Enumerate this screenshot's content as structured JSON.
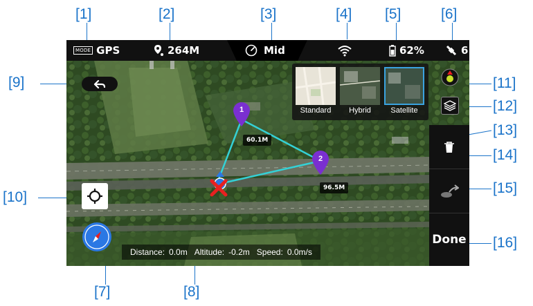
{
  "callouts": [
    "[1]",
    "[2]",
    "[3]",
    "[4]",
    "[5]",
    "[6]",
    "[7]",
    "[8]",
    "[9]",
    "[10]",
    "[11]",
    "[12]",
    "[13]",
    "[14]",
    "[15]",
    "[16]"
  ],
  "status_bar": {
    "mode_badge": "MODE",
    "gps_label": "GPS",
    "distance": "264M",
    "speed_mode": "Mid",
    "battery": "62%",
    "satellites": "6"
  },
  "map_types": {
    "options": [
      "Standard",
      "Hybrid",
      "Satellite"
    ],
    "selected": "Satellite"
  },
  "waypoints": [
    {
      "number": "1",
      "distance_label": "60.1M"
    },
    {
      "number": "2",
      "distance_label": "96.5M"
    }
  ],
  "info_bar": {
    "distance_label": "Distance:",
    "distance_value": "0.0m",
    "altitude_label": "Altitude:",
    "altitude_value": "-0.2m",
    "speed_label": "Speed:",
    "speed_value": "0.0m/s"
  },
  "done_label": "Done",
  "colors": {
    "callout": "#1a73c9",
    "waypoint_pin": "#7a2fd0",
    "route_line": "#34d1d6",
    "aircraft": "#e82020",
    "compass_blue": "#2b78e4"
  },
  "icons": {
    "back": "back-arrow-icon",
    "locate": "locate-crosshair-icon",
    "compass": "compass-icon",
    "home": "home-point-icon",
    "layers": "layers-icon",
    "delete": "trash-icon",
    "route": "route-icon",
    "wifi": "wifi-icon",
    "battery": "battery-icon",
    "satellite": "satellite-icon",
    "gauge": "speedometer-icon",
    "distance": "distance-pin-icon"
  }
}
